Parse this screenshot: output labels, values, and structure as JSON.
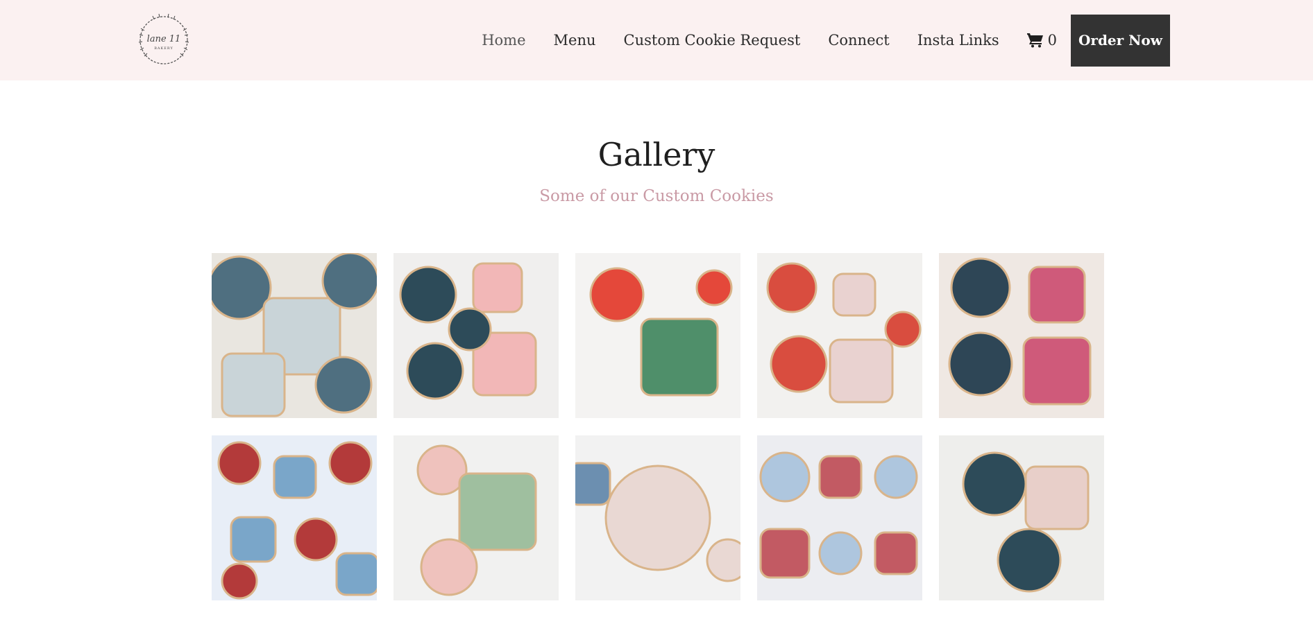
{
  "header": {
    "logo": {
      "line1": "lane 11",
      "line2": "BAKERY"
    },
    "nav": [
      {
        "label": "Home",
        "active": true
      },
      {
        "label": "Menu"
      },
      {
        "label": "Custom Cookie Request"
      },
      {
        "label": "Connect"
      },
      {
        "label": "Insta Links"
      }
    ],
    "cart": {
      "icon": "cart-icon",
      "count": "0"
    },
    "order_button": "Order Now"
  },
  "main": {
    "title": "Gallery",
    "subtitle": "Some of our Custom Cookies"
  },
  "gallery": {
    "items": [
      {
        "name": "hot-air-balloon-baby-cookies",
        "palette": [
          "#e9e6e0",
          "#4f6f80",
          "#c9d4d8"
        ]
      },
      {
        "name": "wine-glass-rose-cookies",
        "palette": [
          "#f0efee",
          "#2d4b59",
          "#f2b7b7"
        ]
      },
      {
        "name": "red-rose-cookies",
        "palette": [
          "#f4f3f2",
          "#e4483a",
          "#4f8f6a"
        ]
      },
      {
        "name": "bridal-proposal-cookies",
        "palette": [
          "#f2f1ef",
          "#d94d3f",
          "#e9d2d0"
        ]
      },
      {
        "name": "name-plaque-cookies",
        "palette": [
          "#efe8e3",
          "#2e4656",
          "#cf5a7a"
        ]
      },
      {
        "name": "school-chalkboard-cookies",
        "palette": [
          "#e8eef7",
          "#b33a3a",
          "#7aa6c9"
        ]
      },
      {
        "name": "pink-rose-bouquet-cookies",
        "palette": [
          "#f1f1f0",
          "#efc2bd",
          "#9fbf9f"
        ]
      },
      {
        "name": "macrame-cookies",
        "palette": [
          "#f2f2f2",
          "#e9d8d3",
          "#6c8fb0"
        ]
      },
      {
        "name": "teacher-fuel-cookies",
        "palette": [
          "#ecedf1",
          "#aec6de",
          "#c25a63"
        ]
      },
      {
        "name": "cake-stand-cookies",
        "palette": [
          "#eeeeec",
          "#2d4b59",
          "#e8cfc9"
        ]
      }
    ]
  }
}
